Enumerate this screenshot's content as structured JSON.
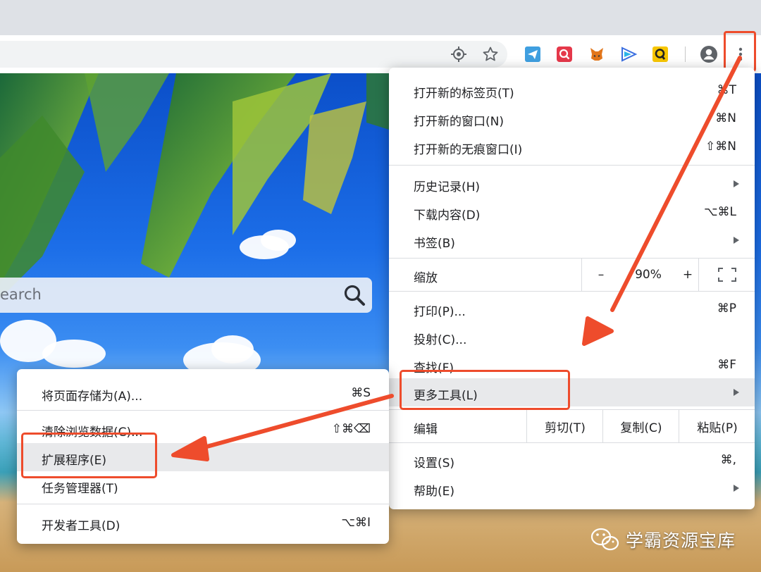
{
  "search": {
    "text": "earch"
  },
  "main_menu": {
    "items": [
      {
        "label": "打开新的标签页(T)",
        "shortcut": "⌘T"
      },
      {
        "label": "打开新的窗口(N)",
        "shortcut": "⌘N"
      },
      {
        "label": "打开新的无痕窗口(I)",
        "shortcut": "⇧⌘N"
      },
      {
        "label": "历史记录(H)"
      },
      {
        "label": "下载内容(D)",
        "shortcut": "⌥⌘L"
      },
      {
        "label": "书签(B)"
      },
      {
        "label": "打印(P)...",
        "shortcut": "⌘P"
      },
      {
        "label": "投射(C)..."
      },
      {
        "label": "查找(F)...",
        "shortcut": "⌘F"
      },
      {
        "label": "更多工具(L)"
      },
      {
        "label": "设置(S)",
        "shortcut": "⌘,"
      },
      {
        "label": "帮助(E)"
      }
    ],
    "zoom": {
      "label": "缩放",
      "minus": "–",
      "value": "90%",
      "plus": "+"
    },
    "edit": {
      "label": "编辑",
      "cut": "剪切(T)",
      "copy": "复制(C)",
      "paste": "粘贴(P)"
    }
  },
  "sub_menu": {
    "items": [
      {
        "label": "将页面存储为(A)...",
        "shortcut": "⌘S"
      },
      {
        "label": "清除浏览数据(C)...",
        "shortcut": "⇧⌘⌫"
      },
      {
        "label": "扩展程序(E)"
      },
      {
        "label": "任务管理器(T)"
      },
      {
        "label": "开发者工具(D)",
        "shortcut": "⌥⌘I"
      }
    ]
  },
  "watermark": {
    "text": "学霸资源宝库"
  },
  "colors": {
    "annotation": "#ee4c2c",
    "highlight": "#e8e9eb"
  }
}
